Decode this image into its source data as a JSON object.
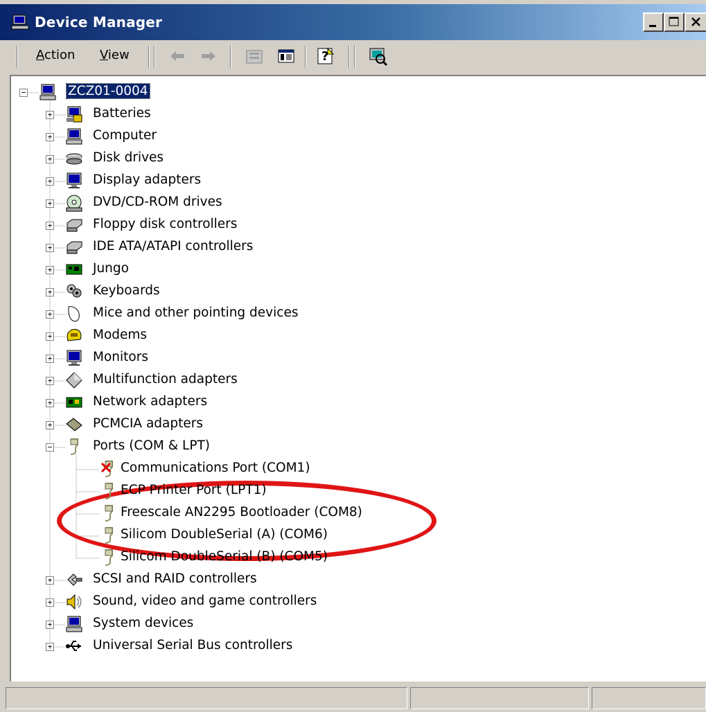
{
  "window": {
    "title": "Device Manager",
    "controls": {
      "minimize": "_",
      "maximize": "□",
      "close": "X"
    }
  },
  "menu": {
    "action_prefix": "A",
    "action_rest": "ction",
    "view_prefix": "V",
    "view_rest": "iew"
  },
  "toolbar": {
    "icons": [
      "back-arrow-icon",
      "forward-arrow-icon",
      "up-folder-icon",
      "show-hide-tree-icon",
      "help-icon",
      "scan-hardware-icon"
    ]
  },
  "tree": {
    "root": {
      "label": "ZCZ01-0004",
      "icon": "computer-icon"
    },
    "categories": [
      {
        "label": "Batteries",
        "icon": "battery-icon",
        "expanded": false
      },
      {
        "label": "Computer",
        "icon": "computer-icon",
        "expanded": false
      },
      {
        "label": "Disk drives",
        "icon": "disk-drive-icon",
        "expanded": false
      },
      {
        "label": "Display adapters",
        "icon": "monitor-icon",
        "expanded": false
      },
      {
        "label": "DVD/CD-ROM drives",
        "icon": "cdrom-icon",
        "expanded": false
      },
      {
        "label": "Floppy disk controllers",
        "icon": "controller-icon",
        "expanded": false
      },
      {
        "label": "IDE ATA/ATAPI controllers",
        "icon": "controller-icon",
        "expanded": false
      },
      {
        "label": "Jungo",
        "icon": "circuit-board-icon",
        "expanded": false
      },
      {
        "label": "Keyboards",
        "icon": "keyboard-icon",
        "expanded": false
      },
      {
        "label": "Mice and other pointing devices",
        "icon": "mouse-icon",
        "expanded": false
      },
      {
        "label": "Modems",
        "icon": "modem-icon",
        "expanded": false
      },
      {
        "label": "Monitors",
        "icon": "monitor-icon",
        "expanded": false
      },
      {
        "label": "Multifunction adapters",
        "icon": "diamond-icon",
        "expanded": false
      },
      {
        "label": "Network adapters",
        "icon": "network-card-icon",
        "expanded": false
      },
      {
        "label": "PCMCIA adapters",
        "icon": "pcmcia-icon",
        "expanded": false
      },
      {
        "label": "Ports (COM & LPT)",
        "icon": "port-connector-icon",
        "expanded": true,
        "children": [
          {
            "label": "Communications Port (COM1)",
            "icon": "port-disabled-icon"
          },
          {
            "label": "ECP Printer Port (LPT1)",
            "icon": "port-connector-icon"
          },
          {
            "label": "Freescale AN2295 Bootloader (COM8)",
            "icon": "port-connector-icon"
          },
          {
            "label": "Silicom DoubleSerial (A) (COM6)",
            "icon": "port-connector-icon"
          },
          {
            "label": "Silicom DoubleSerial (B) (COM5)",
            "icon": "port-connector-icon"
          }
        ]
      },
      {
        "label": "SCSI and RAID controllers",
        "icon": "scsi-icon",
        "expanded": false
      },
      {
        "label": "Sound, video and game controllers",
        "icon": "speaker-icon",
        "expanded": false
      },
      {
        "label": "System devices",
        "icon": "computer-icon",
        "expanded": false
      },
      {
        "label": "Universal Serial Bus controllers",
        "icon": "usb-icon",
        "expanded": false
      }
    ]
  },
  "annotation": {
    "color": "#e01515",
    "target": "Freescale AN2295 Bootloader (COM8)"
  },
  "colors": {
    "title_start": "#0a246a",
    "title_end": "#a6caf0",
    "selection": "#0a246a",
    "face": "#d4d0c8"
  }
}
